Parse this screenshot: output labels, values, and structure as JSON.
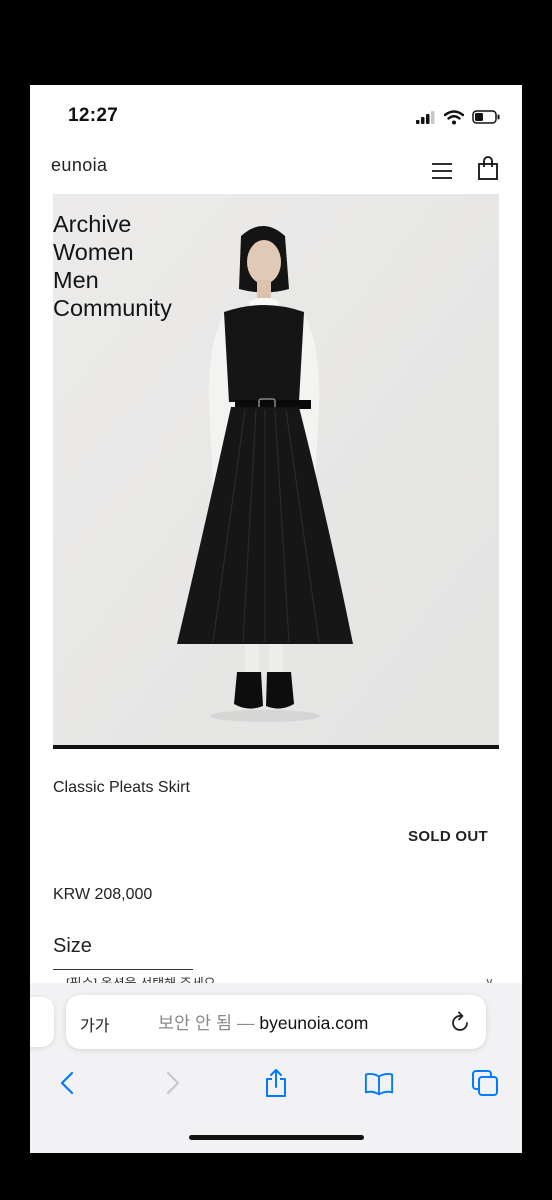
{
  "status_bar": {
    "time": "12:27"
  },
  "site": {
    "logo": "eunoia"
  },
  "hero_nav": {
    "items": [
      "Archive",
      "Women",
      "Men",
      "Community"
    ]
  },
  "product": {
    "name": "Classic Pleats Skirt",
    "status": "SOLD OUT",
    "price": "KRW 208,000",
    "size_label": "Size",
    "option_placeholder": "[필수] 옵션을 선택해 주세요"
  },
  "browser": {
    "text_size_label": "가가",
    "security_warning": "보안 안 됨",
    "separator": " — ",
    "domain": "byeunoia.com"
  },
  "colors": {
    "accent": "#007aff",
    "disabled": "#c7c7cc"
  }
}
